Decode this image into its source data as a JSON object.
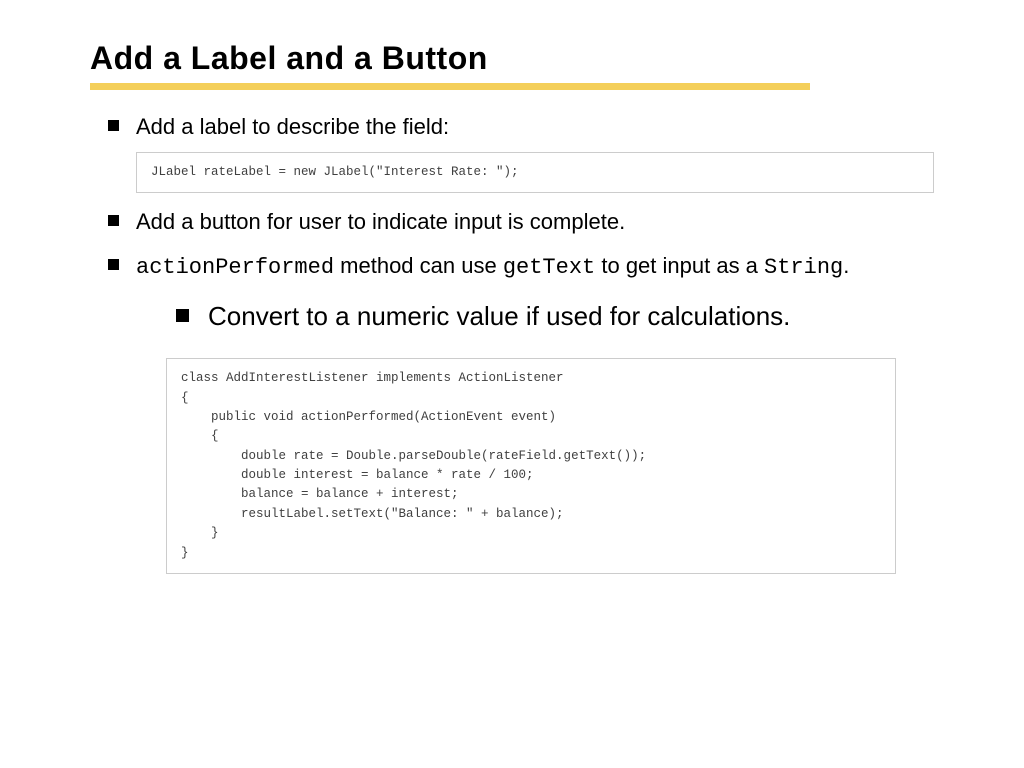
{
  "title": "Add a Label and a Button",
  "bullets": {
    "b1": "Add a label to describe the field:",
    "b2": "Add a button for user to indicate input is complete.",
    "b3a": "actionPerformed",
    "b3b": " method can use ",
    "b3c": "getText",
    "b3d": " to get input as a ",
    "b3e": "String",
    "b3f": ".",
    "sub1": "Convert to a numeric value if used for calculations."
  },
  "code1": "JLabel rateLabel = new JLabel(\"Interest Rate: \");",
  "code2": "class AddInterestListener implements ActionListener\n{\n    public void actionPerformed(ActionEvent event)\n    {\n        double rate = Double.parseDouble(rateField.getText());\n        double interest = balance * rate / 100;\n        balance = balance + interest;\n        resultLabel.setText(\"Balance: \" + balance);\n    }\n}"
}
